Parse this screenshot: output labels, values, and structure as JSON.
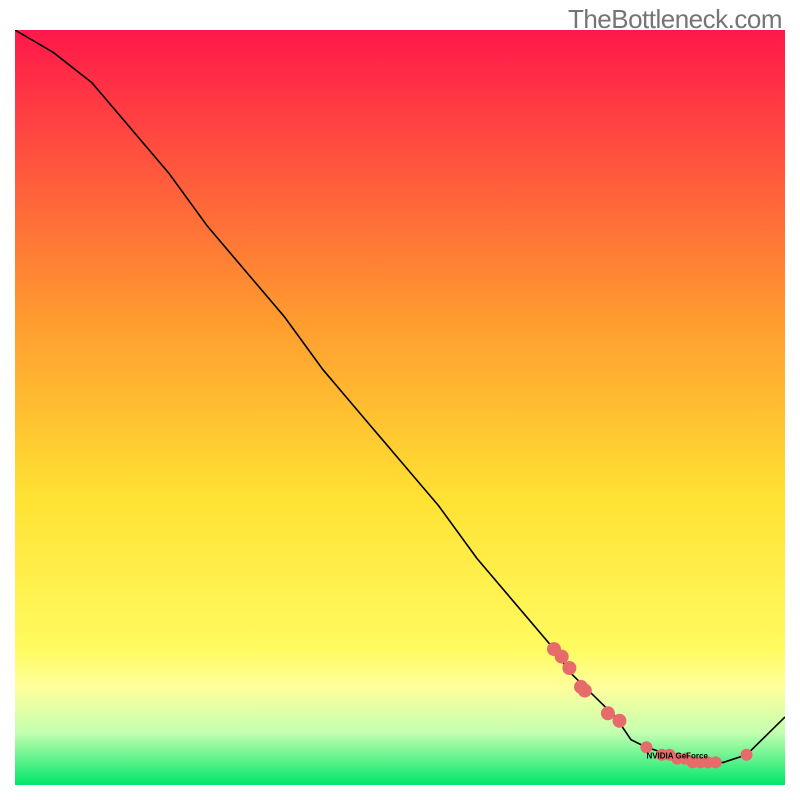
{
  "watermark": "TheBottleneck.com",
  "chart_data": {
    "type": "line",
    "title": "",
    "xlabel": "",
    "ylabel": "",
    "xlim": [
      0,
      100
    ],
    "ylim": [
      0,
      100
    ],
    "grid": false,
    "background_gradient": true,
    "line": {
      "x": [
        0,
        5,
        10,
        15,
        20,
        25,
        30,
        35,
        40,
        45,
        50,
        55,
        60,
        65,
        70,
        72,
        75,
        78,
        80,
        82,
        85,
        87,
        90,
        92,
        95,
        100
      ],
      "y": [
        100,
        97,
        93,
        87,
        81,
        74,
        68,
        62,
        55,
        49,
        43,
        37,
        30,
        24,
        18,
        15,
        12,
        9,
        6,
        5,
        4,
        3,
        3,
        3,
        4,
        9
      ]
    },
    "markers": {
      "series1_x": [
        70,
        71,
        72,
        73.5,
        74,
        77,
        78.5
      ],
      "series1_y": [
        18,
        17,
        15.5,
        13,
        12.5,
        9.5,
        8.5
      ],
      "series2_x": [
        82,
        84,
        85,
        86,
        87,
        88,
        89,
        90,
        91,
        95
      ],
      "series2_y": [
        5,
        4,
        4,
        3.5,
        3.5,
        3,
        3,
        3,
        3,
        4
      ]
    },
    "label": {
      "text": "NVIDIA GeForce",
      "x": 86,
      "y": 3.5
    }
  },
  "colors": {
    "gradient_top": "#ff184a",
    "gradient_mid1": "#ff9a2f",
    "gradient_mid2": "#ffe233",
    "gradient_mid3": "#fffb60",
    "gradient_near_bottom": "#c5ffb0",
    "gradient_bottom": "#00e66a",
    "marker": "#e86b6b",
    "line": "#000000",
    "label": "#000000"
  }
}
